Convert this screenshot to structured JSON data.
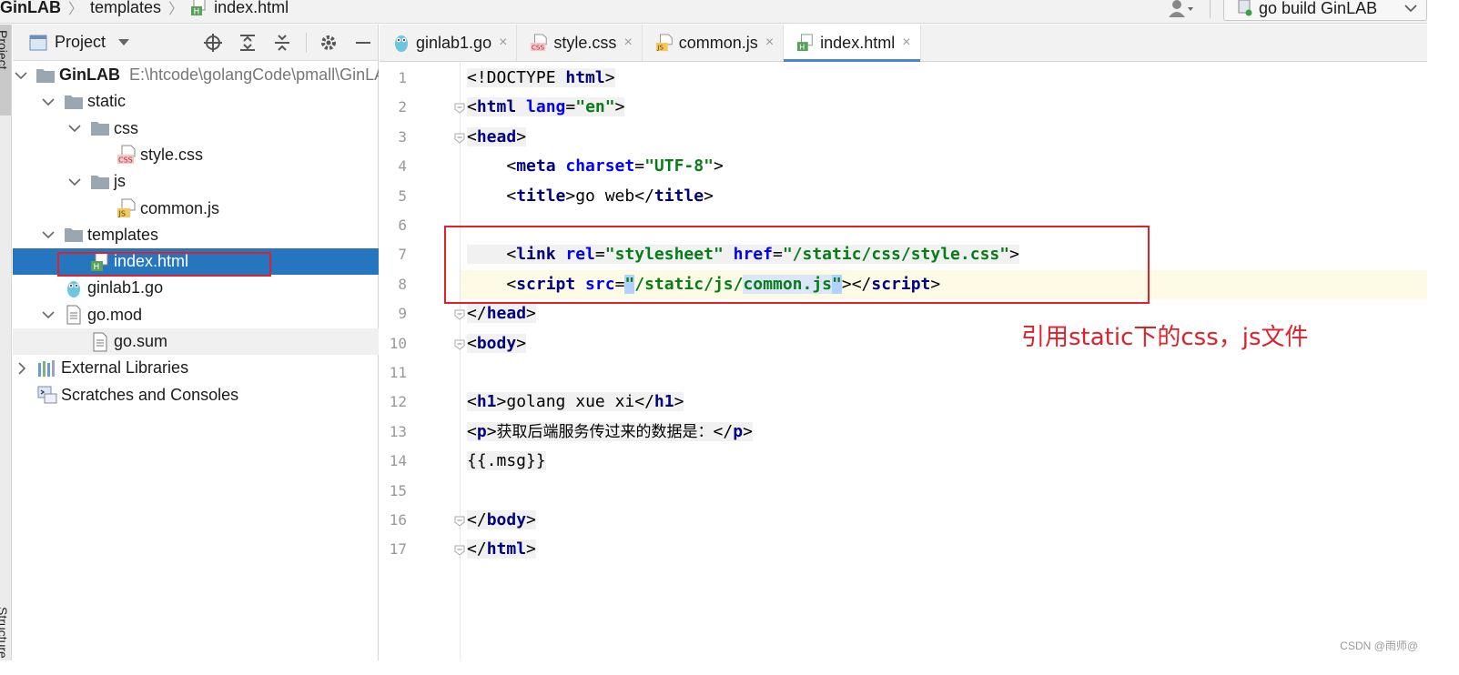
{
  "navbar": {
    "project": "GinLAB",
    "crumbs": [
      "templates",
      "index.html"
    ],
    "run_config": "go build GinLAB"
  },
  "tool_strip": {
    "top_tab": "Project",
    "bottom_tab": "Structure"
  },
  "project_panel": {
    "title": "Project",
    "tree": [
      {
        "label": "GinLAB",
        "path": "E:\\htcode\\golangCode\\pmall\\GinLAB",
        "icon": "folder-icon",
        "arrow": "expanded",
        "depth": 0,
        "bold": true
      },
      {
        "label": "static",
        "icon": "folder-icon",
        "arrow": "expanded",
        "depth": 1
      },
      {
        "label": "css",
        "icon": "folder-icon",
        "arrow": "expanded",
        "depth": 2
      },
      {
        "label": "style.css",
        "icon": "css-file-icon",
        "arrow": "none",
        "depth": 3
      },
      {
        "label": "js",
        "icon": "folder-icon",
        "arrow": "expanded",
        "depth": 2
      },
      {
        "label": "common.js",
        "icon": "js-file-icon",
        "arrow": "none",
        "depth": 3
      },
      {
        "label": "templates",
        "icon": "folder-icon",
        "arrow": "expanded",
        "depth": 1
      },
      {
        "label": "index.html",
        "icon": "html-file-icon",
        "arrow": "none",
        "depth": 2,
        "selected": true
      },
      {
        "label": "ginlab1.go",
        "icon": "go-file-icon",
        "arrow": "none",
        "depth": 1
      },
      {
        "label": "go.mod",
        "icon": "text-file-icon",
        "arrow": "expanded",
        "depth": 1
      },
      {
        "label": "go.sum",
        "icon": "text-file-icon",
        "arrow": "none",
        "depth": 2,
        "hover": true
      },
      {
        "label": "External Libraries",
        "icon": "libraries-icon",
        "arrow": "collapsed",
        "depth": 0
      },
      {
        "label": "Scratches and Consoles",
        "icon": "scratches-icon",
        "arrow": "none",
        "depth": 0
      }
    ]
  },
  "tabs": [
    {
      "label": "ginlab1.go",
      "icon": "go-file-icon",
      "close": "×"
    },
    {
      "label": "style.css",
      "icon": "css-file-icon",
      "close": "×"
    },
    {
      "label": "common.js",
      "icon": "js-file-icon",
      "close": "×"
    },
    {
      "label": "index.html",
      "icon": "html-file-icon",
      "close": "×",
      "active": true
    }
  ],
  "editor": {
    "lines": [
      {
        "n": "1",
        "fold": false,
        "tokens": [
          [
            "t",
            "<!DOCTYPE "
          ],
          [
            "tag",
            "html"
          ],
          [
            "t",
            ">"
          ]
        ]
      },
      {
        "n": "2",
        "fold": true,
        "tokens": [
          [
            "t",
            "<"
          ],
          [
            "tag",
            "html "
          ],
          [
            "attr",
            "lang"
          ],
          [
            "t",
            "="
          ],
          [
            "str",
            "\"en\""
          ],
          [
            "t",
            ">"
          ]
        ]
      },
      {
        "n": "3",
        "fold": true,
        "tokens": [
          [
            "t",
            "<"
          ],
          [
            "tag",
            "head"
          ],
          [
            "t",
            ">"
          ]
        ]
      },
      {
        "n": "4",
        "fold": false,
        "tokens": [
          [
            "t",
            "    <"
          ],
          [
            "tag",
            "meta "
          ],
          [
            "attr",
            "charset"
          ],
          [
            "t",
            "="
          ],
          [
            "str",
            "\"UTF-8\""
          ],
          [
            "t",
            ">"
          ]
        ]
      },
      {
        "n": "5",
        "fold": false,
        "tokens": [
          [
            "t",
            "    <"
          ],
          [
            "tag",
            "title"
          ],
          [
            "t",
            ">go web</"
          ],
          [
            "tag",
            "title"
          ],
          [
            "t",
            ">"
          ]
        ]
      },
      {
        "n": "6",
        "fold": false,
        "tokens": []
      },
      {
        "n": "7",
        "fold": false,
        "tokens": [
          [
            "t",
            "    <"
          ],
          [
            "tag",
            "link "
          ],
          [
            "attr",
            "rel"
          ],
          [
            "t",
            "="
          ],
          [
            "str",
            "\"stylesheet\" "
          ],
          [
            "attr",
            "href"
          ],
          [
            "t",
            "="
          ],
          [
            "str",
            "\"/static/css/style.css\""
          ],
          [
            "t",
            ">"
          ]
        ]
      },
      {
        "n": "8",
        "fold": false,
        "current": true,
        "tokens": [
          [
            "t",
            "    <"
          ],
          [
            "tag",
            "script "
          ],
          [
            "attr",
            "src"
          ],
          [
            "t",
            "="
          ],
          [
            "caret",
            "\""
          ],
          [
            "str",
            "/static/js/"
          ],
          [
            "hl",
            "common.js"
          ],
          [
            "caret",
            "\""
          ],
          [
            "t",
            "></"
          ],
          [
            "tag",
            "script"
          ],
          [
            "t",
            ">"
          ]
        ]
      },
      {
        "n": "9",
        "fold": true,
        "tokens": [
          [
            "t",
            "</"
          ],
          [
            "tag",
            "head"
          ],
          [
            "t",
            ">"
          ]
        ]
      },
      {
        "n": "10",
        "fold": true,
        "tokens": [
          [
            "t",
            "<"
          ],
          [
            "tag",
            "body"
          ],
          [
            "t",
            ">"
          ]
        ]
      },
      {
        "n": "11",
        "fold": false,
        "tokens": []
      },
      {
        "n": "12",
        "fold": false,
        "tokens": [
          [
            "t",
            "<"
          ],
          [
            "tag",
            "h1"
          ],
          [
            "t",
            ">golang xue xi</"
          ],
          [
            "tag",
            "h1"
          ],
          [
            "t",
            ">"
          ]
        ]
      },
      {
        "n": "13",
        "fold": false,
        "tokens": [
          [
            "t",
            "<"
          ],
          [
            "tag",
            "p"
          ],
          [
            "t",
            ">"
          ],
          [
            "cn",
            "获取后端服务传过来的数据是："
          ],
          [
            "t",
            "</"
          ],
          [
            "tag",
            "p"
          ],
          [
            "t",
            ">"
          ]
        ]
      },
      {
        "n": "14",
        "fold": false,
        "tokens": [
          [
            "t",
            "{{.msg}}"
          ]
        ]
      },
      {
        "n": "15",
        "fold": false,
        "tokens": []
      },
      {
        "n": "16",
        "fold": true,
        "tokens": [
          [
            "t",
            "</"
          ],
          [
            "tag",
            "body"
          ],
          [
            "t",
            ">"
          ]
        ]
      },
      {
        "n": "17",
        "fold": true,
        "tokens": [
          [
            "t",
            "</"
          ],
          [
            "tag",
            "html"
          ],
          [
            "t",
            ">"
          ]
        ]
      }
    ]
  },
  "annotation": "引用static下的css，js文件",
  "watermark": "CSDN @雨师@",
  "colors": {
    "accent": "#2675bf",
    "highlight_box": "#e0202a",
    "tag": "#000080",
    "attr": "#0000ff",
    "string": "#067d17"
  }
}
